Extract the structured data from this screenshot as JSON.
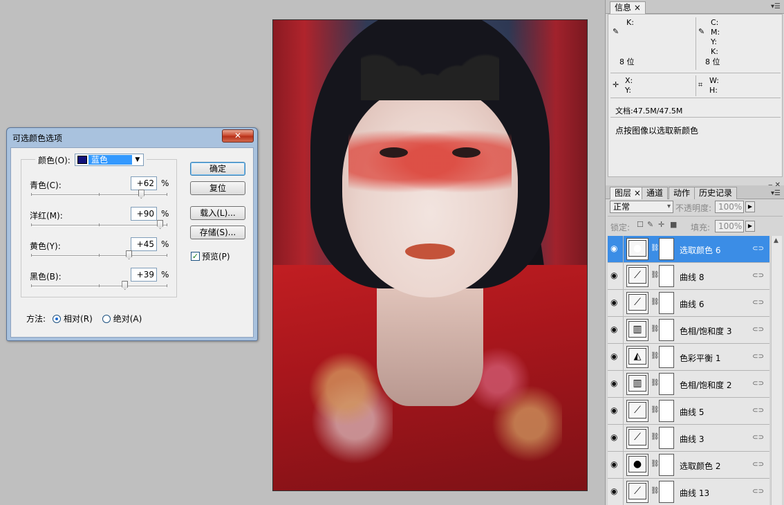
{
  "dialog": {
    "title": "可选颜色选项",
    "close_label": "✕",
    "color_label": "颜色(O):",
    "color_value": "蓝色",
    "sliders": [
      {
        "label": "青色(C):",
        "value": "+62",
        "fraction": 0.81
      },
      {
        "label": "洋红(M):",
        "value": "+90",
        "fraction": 0.95
      },
      {
        "label": "黄色(Y):",
        "value": "+45",
        "fraction": 0.72
      },
      {
        "label": "黑色(B):",
        "value": "+39",
        "fraction": 0.69
      }
    ],
    "percent": "%",
    "buttons": {
      "ok": "确定",
      "reset": "复位",
      "load": "载入(L)...",
      "save": "存储(S)..."
    },
    "preview_label": "预览(P)",
    "preview_check": "✓",
    "method_label": "方法:",
    "method_relative": "相对(R)",
    "method_absolute": "绝对(A)"
  },
  "info_panel": {
    "tab": "信息",
    "tab_close": "×",
    "k_label": "K:",
    "c_label": "C:",
    "m_label": "M:",
    "y_label": "Y:",
    "k2_label": "K:",
    "bits_left": "8 位",
    "bits_right": "8 位",
    "x_label": "X:",
    "y2_label": "Y:",
    "w_label": "W:",
    "h_label": "H:",
    "doc": "文档:47.5M/47.5M",
    "hint": "点按图像以选取新颜色"
  },
  "layers_panel": {
    "tabs": [
      "图层",
      "通道",
      "动作",
      "历史记录"
    ],
    "tab_close": "×",
    "blend_mode": "正常",
    "opacity_label": "不透明度:",
    "opacity_value": "100%",
    "lock_label": "锁定:",
    "fill_label": "填充:",
    "fill_value": "100%",
    "layers": [
      {
        "name": "选取颜色 6",
        "icon": "●",
        "selected": true
      },
      {
        "name": "曲线 8",
        "icon": "⟋",
        "selected": false
      },
      {
        "name": "曲线 6",
        "icon": "⟋",
        "selected": false
      },
      {
        "name": "色相/饱和度 3",
        "icon": "▥",
        "selected": false
      },
      {
        "name": "色彩平衡 1",
        "icon": "◭",
        "selected": false
      },
      {
        "name": "色相/饱和度 2",
        "icon": "▥",
        "selected": false
      },
      {
        "name": "曲线 5",
        "icon": "⟋",
        "selected": false
      },
      {
        "name": "曲线 3",
        "icon": "⟋",
        "selected": false
      },
      {
        "name": "选取颜色 2",
        "icon": "●",
        "selected": false
      },
      {
        "name": "曲线 13",
        "icon": "⟋",
        "selected": false
      }
    ]
  }
}
